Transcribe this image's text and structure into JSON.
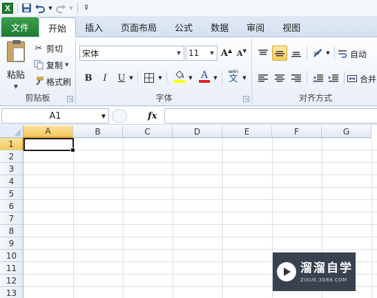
{
  "quick_access": {
    "app_icon": "excel-logo-icon",
    "app_letter": "X",
    "save_icon": "save-icon",
    "undo_icon": "undo-icon",
    "redo_icon": "redo-icon",
    "customize_icon": "customize-qat-icon"
  },
  "tabs": {
    "file": "文件",
    "items": [
      "开始",
      "插入",
      "页面布局",
      "公式",
      "数据",
      "审阅",
      "视图"
    ],
    "active_index": 0
  },
  "ribbon": {
    "clipboard": {
      "paste": "粘贴",
      "cut": "剪切",
      "copy": "复制",
      "format_painter": "格式刷",
      "label": "剪贴板"
    },
    "font": {
      "font_name": "宋体",
      "font_size": "11",
      "grow_glyph": "A",
      "shrink_glyph": "A",
      "bold": "B",
      "italic": "I",
      "underline": "U",
      "font_color_glyph": "A",
      "phonetic_glyph": "文",
      "phonetic_small": "wén",
      "label": "字体",
      "highlight_color": "#ffff00",
      "font_color": "#e02020"
    },
    "alignment": {
      "wrap_text": "自动",
      "merge_center": "合并",
      "label": "对齐方式"
    }
  },
  "formula_bar": {
    "name_box": "A1",
    "fx": "fx",
    "formula": ""
  },
  "grid": {
    "columns": [
      "A",
      "B",
      "C",
      "D",
      "E",
      "F",
      "G"
    ],
    "rows": [
      "1",
      "2",
      "3",
      "4",
      "5",
      "6",
      "7",
      "8",
      "9",
      "10",
      "11",
      "12",
      "13"
    ],
    "active_cell": "A1",
    "accent": "#f5c85a"
  },
  "watermark": {
    "title": "溜溜自学",
    "url": "ZIXUE.3D66.COM"
  }
}
